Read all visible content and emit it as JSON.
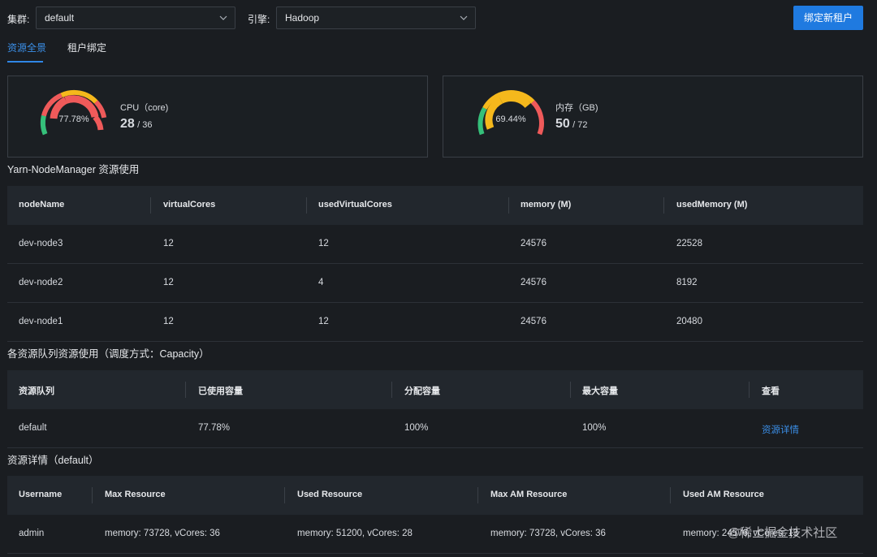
{
  "filters": {
    "cluster_label": "集群:",
    "cluster_value": "default",
    "engine_label": "引擎:",
    "engine_value": "Hadoop",
    "bind_button": "绑定新租户"
  },
  "tabs": [
    {
      "label": "资源全景",
      "active": true
    },
    {
      "label": "租户绑定",
      "active": false
    }
  ],
  "cpu": {
    "percent_label": "77.78%",
    "percent": 0.7778,
    "name": "CPU（core)",
    "used": "28",
    "total": "/ 36"
  },
  "mem": {
    "percent_label": "69.44%",
    "percent": 0.6944,
    "name": "内存（GB)",
    "used": "50",
    "total": "/ 72"
  },
  "nodes": {
    "title": "Yarn-NodeManager 资源使用",
    "headers": [
      "nodeName",
      "virtualCores",
      "usedVirtualCores",
      "memory (M)",
      "usedMemory (M)"
    ],
    "rows": [
      [
        "dev-node3",
        "12",
        "12",
        "24576",
        "22528"
      ],
      [
        "dev-node2",
        "12",
        "4",
        "24576",
        "8192"
      ],
      [
        "dev-node1",
        "12",
        "12",
        "24576",
        "20480"
      ]
    ]
  },
  "queues": {
    "title": "各资源队列资源使用（调度方式：Capacity）",
    "headers": [
      "资源队列",
      "已使用容量",
      "分配容量",
      "最大容量",
      "查看"
    ],
    "rows": [
      [
        "default",
        "77.78%",
        "100%",
        "100%",
        "资源详情"
      ]
    ]
  },
  "details": {
    "title": "资源详情（default）",
    "headers": [
      "Username",
      "Max Resource",
      "Used Resource",
      "Max AM Resource",
      "Used AM Resource"
    ],
    "rows": [
      [
        "admin",
        "memory: 73728,  vCores: 36",
        "memory: 51200,  vCores: 28",
        "memory: 73728,  vCores: 36",
        "memory: 24576,  vCores: 13"
      ]
    ]
  },
  "watermark": "@稀土掘金技术社区",
  "colors": {
    "accent": "#1f7ae0",
    "gauge_green": "#35c07a",
    "gauge_yellow": "#f5b81c",
    "gauge_red": "#ef5a5a"
  }
}
